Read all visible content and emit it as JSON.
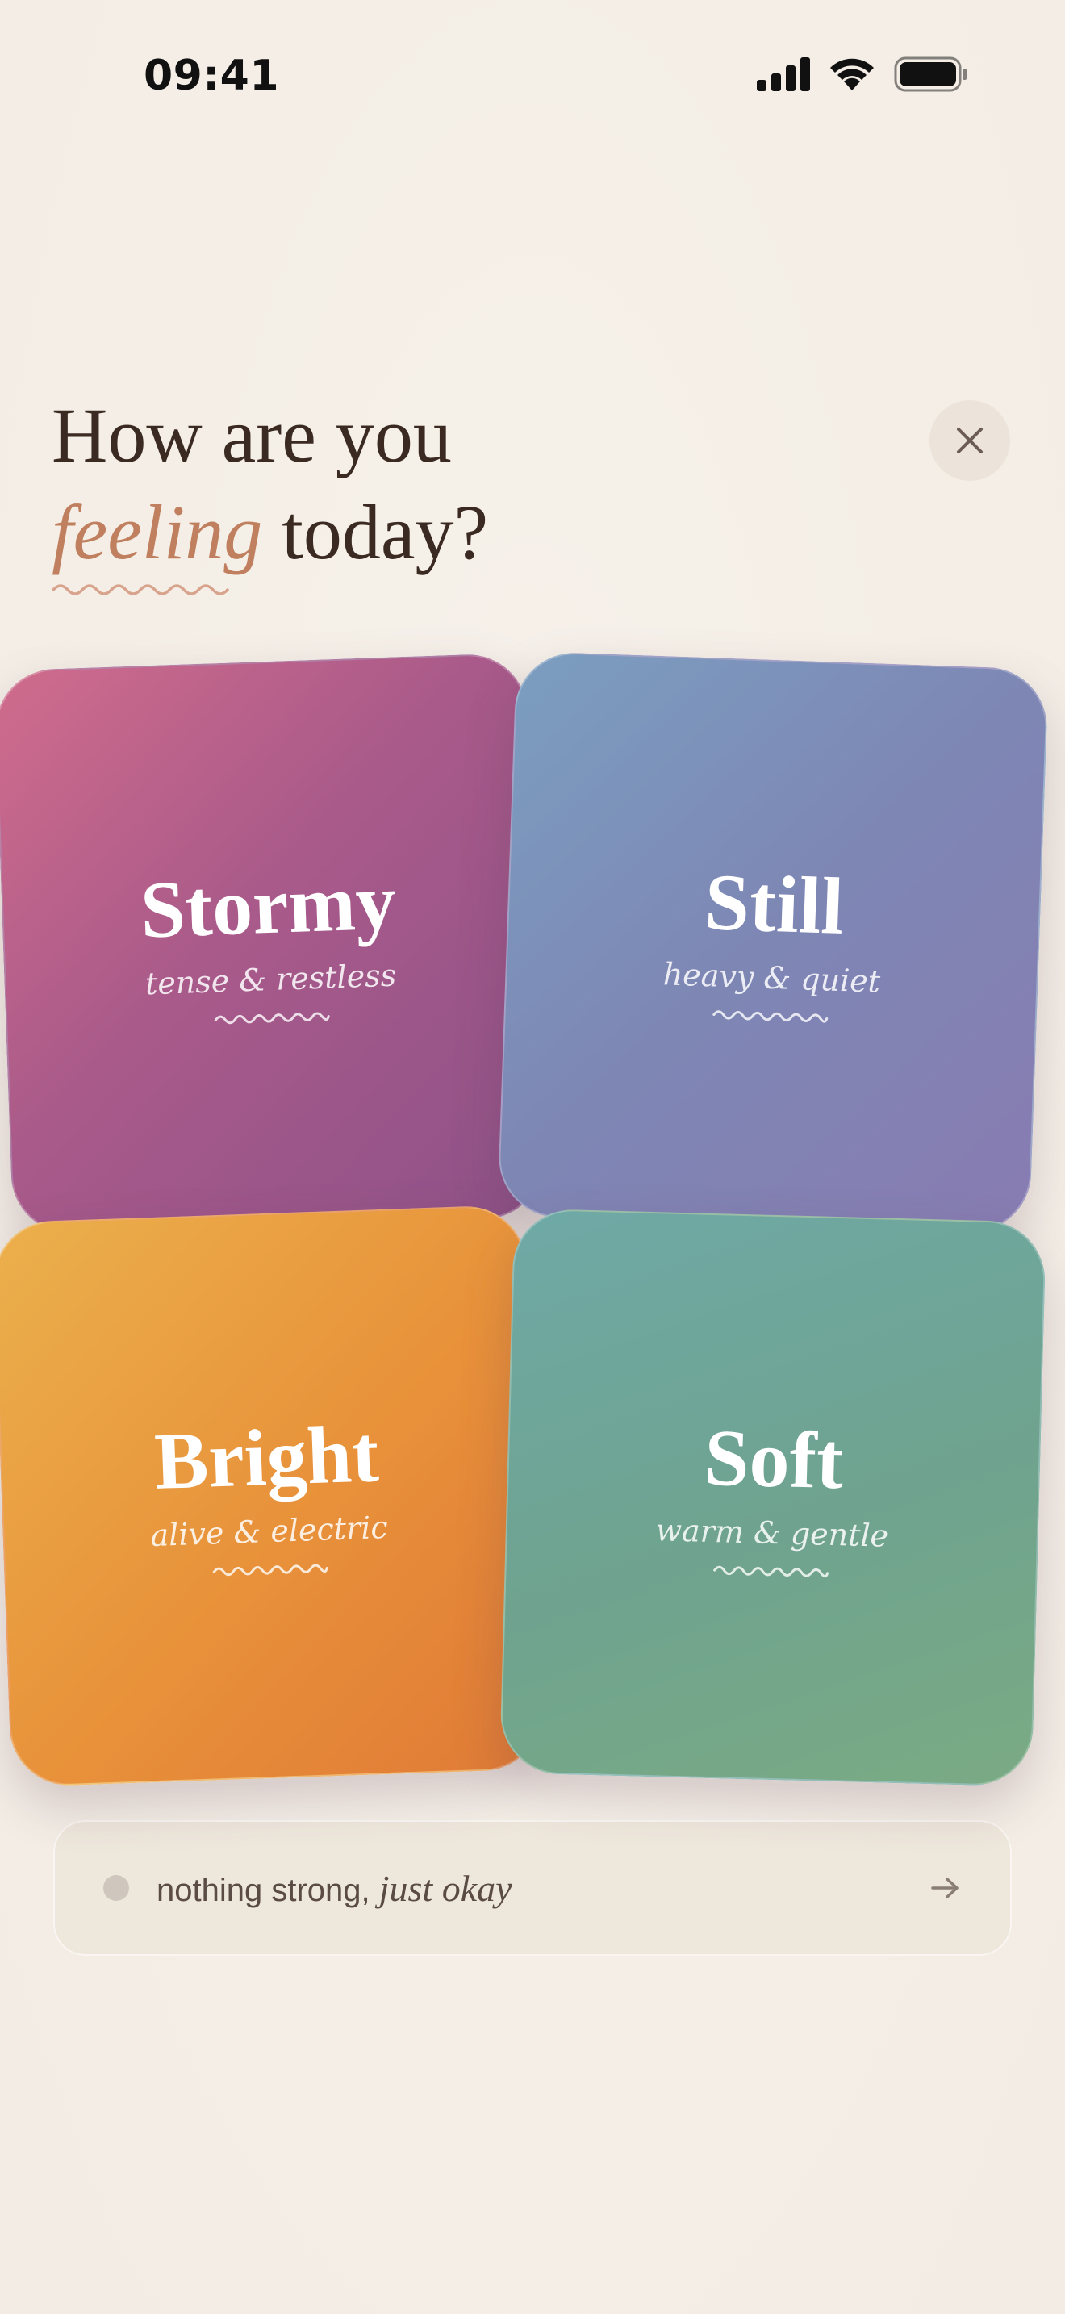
{
  "status_bar": {
    "time": "09:41",
    "icons": [
      "cellular-signal-icon",
      "wifi-icon",
      "battery-icon"
    ]
  },
  "header": {
    "title_line1": "How are you",
    "title_accent": "feeling",
    "title_line2_rest": " today?",
    "close_icon": "close-icon"
  },
  "moods": [
    {
      "id": "stormy",
      "title": "Stormy",
      "subtitle": "tense & restless"
    },
    {
      "id": "still",
      "title": "Still",
      "subtitle": "heavy & quiet"
    },
    {
      "id": "bright",
      "title": "Bright",
      "subtitle": "alive & electric"
    },
    {
      "id": "soft",
      "title": "Soft",
      "subtitle": "warm & gentle"
    }
  ],
  "neutral_option": {
    "text": "nothing strong, ",
    "italic_text": "just okay",
    "arrow_icon": "arrow-right-icon"
  },
  "colors": {
    "background": "#f5f0e8",
    "accent": "#c0805f",
    "title": "#3a2a22",
    "stormy": "#b25d8a",
    "still": "#7e88b6",
    "bright": "#e8913a",
    "soft": "#70a68e"
  }
}
